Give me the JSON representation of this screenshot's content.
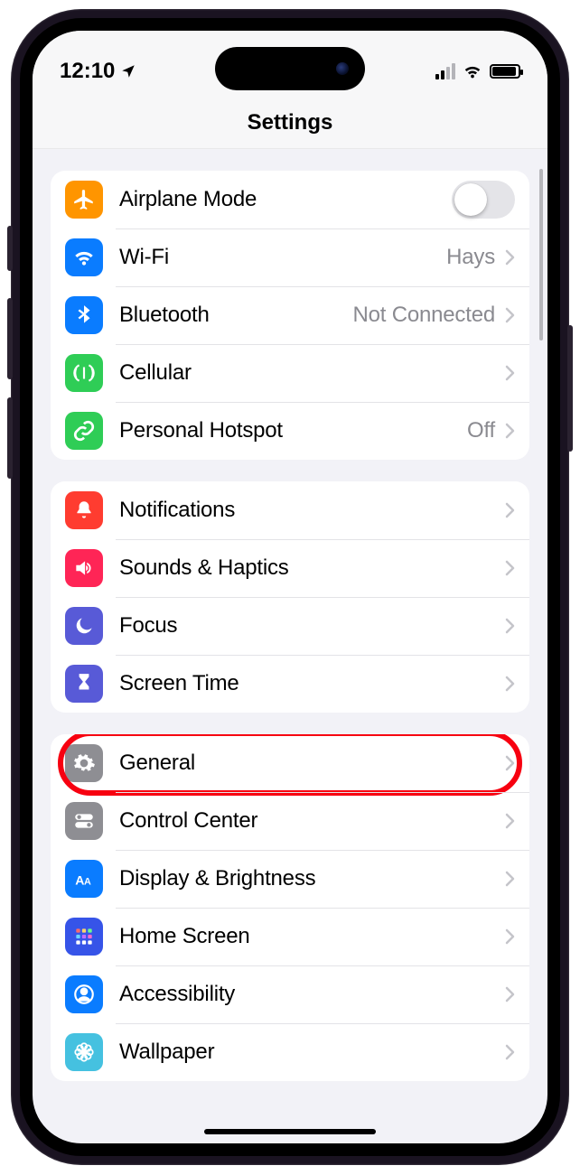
{
  "status": {
    "time": "12:10"
  },
  "header": {
    "title": "Settings"
  },
  "groups": [
    {
      "rows": [
        {
          "id": "airplane",
          "label": "Airplane Mode",
          "value": "",
          "type": "switch",
          "icon": "airplane",
          "bg": "ic-orange"
        },
        {
          "id": "wifi",
          "label": "Wi-Fi",
          "value": "Hays",
          "type": "nav",
          "icon": "wifi",
          "bg": "ic-blue"
        },
        {
          "id": "bluetooth",
          "label": "Bluetooth",
          "value": "Not Connected",
          "type": "nav",
          "icon": "bluetooth",
          "bg": "ic-blue"
        },
        {
          "id": "cellular",
          "label": "Cellular",
          "value": "",
          "type": "nav",
          "icon": "cellular",
          "bg": "ic-green"
        },
        {
          "id": "hotspot",
          "label": "Personal Hotspot",
          "value": "Off",
          "type": "nav",
          "icon": "link",
          "bg": "ic-green"
        }
      ]
    },
    {
      "rows": [
        {
          "id": "notifications",
          "label": "Notifications",
          "value": "",
          "type": "nav",
          "icon": "bell",
          "bg": "ic-red"
        },
        {
          "id": "sounds",
          "label": "Sounds & Haptics",
          "value": "",
          "type": "nav",
          "icon": "speaker",
          "bg": "ic-pink"
        },
        {
          "id": "focus",
          "label": "Focus",
          "value": "",
          "type": "nav",
          "icon": "moon",
          "bg": "ic-indigo"
        },
        {
          "id": "screentime",
          "label": "Screen Time",
          "value": "",
          "type": "nav",
          "icon": "hourglass",
          "bg": "ic-indigo"
        }
      ]
    },
    {
      "rows": [
        {
          "id": "general",
          "label": "General",
          "value": "",
          "type": "nav",
          "icon": "gear",
          "bg": "ic-grey",
          "highlighted": true
        },
        {
          "id": "controlcenter",
          "label": "Control Center",
          "value": "",
          "type": "nav",
          "icon": "toggles",
          "bg": "ic-grey"
        },
        {
          "id": "display",
          "label": "Display & Brightness",
          "value": "",
          "type": "nav",
          "icon": "aa",
          "bg": "ic-blue"
        },
        {
          "id": "homescreen",
          "label": "Home Screen",
          "value": "",
          "type": "nav",
          "icon": "grid",
          "bg": "ic-navy"
        },
        {
          "id": "accessibility",
          "label": "Accessibility",
          "value": "",
          "type": "nav",
          "icon": "person",
          "bg": "ic-blue"
        },
        {
          "id": "wallpaper",
          "label": "Wallpaper",
          "value": "",
          "type": "nav",
          "icon": "flower",
          "bg": "ic-cyan"
        }
      ]
    }
  ]
}
